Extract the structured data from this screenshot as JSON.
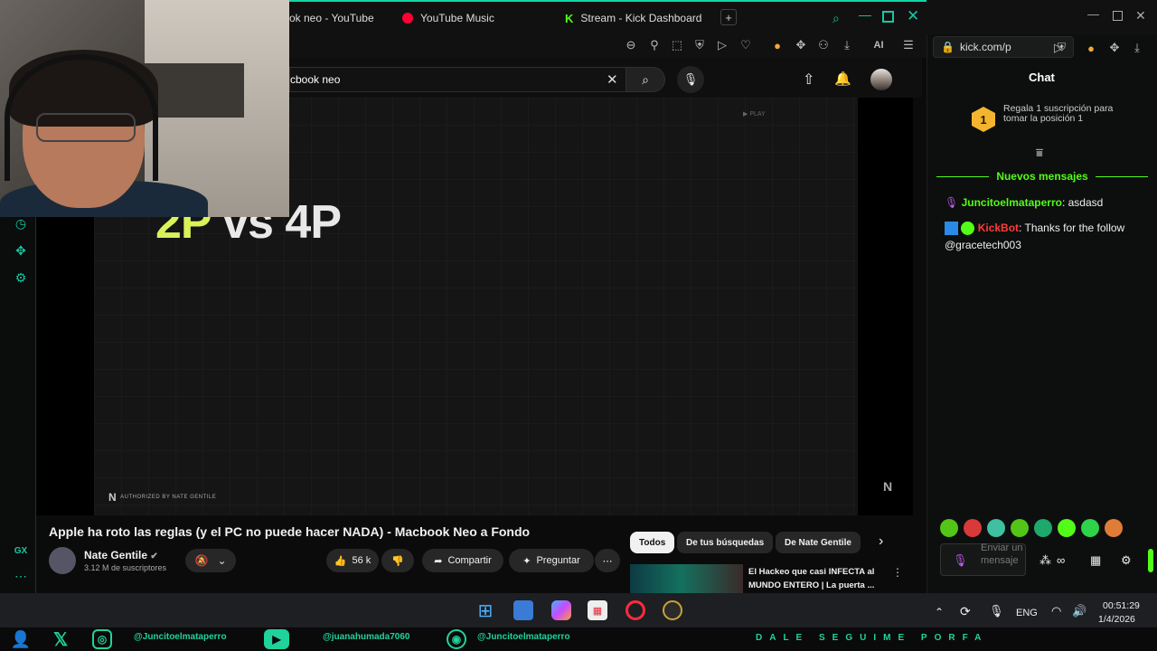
{
  "browser": {
    "tabs": [
      {
        "label": "ok neo - YouTube"
      },
      {
        "label": "YouTube Music"
      },
      {
        "label": "Stream - Kick Dashboard"
      }
    ],
    "new_tab": "+",
    "ai_label": "AI"
  },
  "youtube": {
    "search_value": "cbook neo",
    "video_overlay_text_accent": "2P",
    "video_overlay_text_rest": " vs 4P",
    "video_watermark": "AUTHORIZED BY NATE GENTILE",
    "video_corner_text": "▶ PLAY",
    "video_title": "Apple ha roto las reglas (y el PC no puede hacer NADA) - Macbook Neo a Fondo",
    "channel_name": "Nate Gentile",
    "channel_subs": "3.12 M de suscriptores",
    "likes": "56 k",
    "share_label": "Compartir",
    "ask_label": "Preguntar",
    "chips": [
      "Todos",
      "De tus búsquedas",
      "De Nate Gentile"
    ],
    "recommended_title": "El Hackeo que casi INFECTA al MUNDO ENTERO | La puerta ..."
  },
  "sidebar": {
    "bottom_label": "GX"
  },
  "kick": {
    "url": "kick.com/p",
    "chat_heading": "Chat",
    "gift_rank": "1",
    "gift_text": "Regala 1 suscripción para tomar la posición 1",
    "new_messages": "Nuevos mensajes",
    "messages": [
      {
        "user": "Juncitoelmataperro",
        "text": "asdasd",
        "color": "#53fc18"
      },
      {
        "user": "KickBot",
        "text": "Thanks for the follow @gracetech003",
        "color": "#ff3b3b"
      }
    ],
    "input_placeholder": "Enviar un mensaje"
  },
  "taskbar": {
    "lang": "ENG",
    "time": "00:51:29",
    "date": "1/4/2026"
  },
  "footer": {
    "handles": [
      "@Juncitoelmataperro",
      "@juanahumada7060",
      "@Juncitoelmataperro"
    ],
    "slogan": "DALE SEGUIME PORFA"
  },
  "colors": {
    "accent": "#0fd6a6",
    "kick_green": "#53fc18",
    "youtube_red": "#ff0033"
  }
}
